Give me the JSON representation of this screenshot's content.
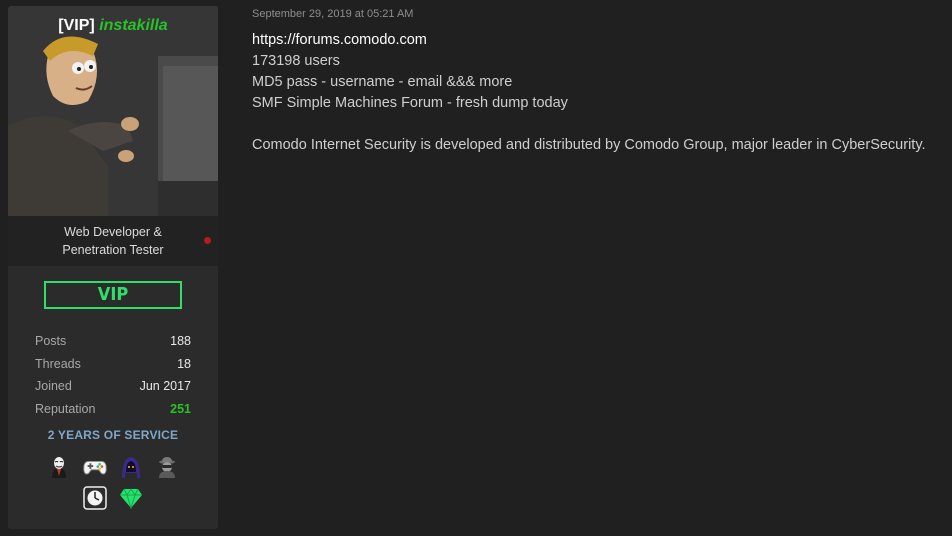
{
  "user": {
    "rank_tag": "[VIP]",
    "username": "instakilla",
    "user_title_line1": "Web Developer &",
    "user_title_line2": "Penetration Tester",
    "badge_label": "VIP",
    "stats": [
      {
        "label": "Posts",
        "value": "188"
      },
      {
        "label": "Threads",
        "value": "18"
      },
      {
        "label": "Joined",
        "value": "Jun 2017"
      },
      {
        "label": "Reputation",
        "value": "251"
      }
    ],
    "service_label": "2 YEARS OF SERVICE",
    "awards": [
      "anonymous-mask-icon",
      "gamepad-icon",
      "hooded-hacker-icon",
      "spy-icon",
      "clock-icon",
      "diamond-icon"
    ],
    "status_color": "#b51d1d"
  },
  "post": {
    "timestamp": "September 29, 2019 at 05:21 AM",
    "lines": [
      "https://forums.comodo.com",
      "173198 users",
      "MD5 pass - username - email &&& more",
      "SMF Simple Machines Forum - fresh dump today",
      "",
      "Comodo Internet Security is developed and distributed by Comodo Group, major leader in CyberSecurity."
    ]
  },
  "colors": {
    "accent_green": "#2ee06a",
    "username_green": "#27c227",
    "service_blue": "#7fa7c9",
    "background": "#202020",
    "card": "#2b2b2b"
  }
}
